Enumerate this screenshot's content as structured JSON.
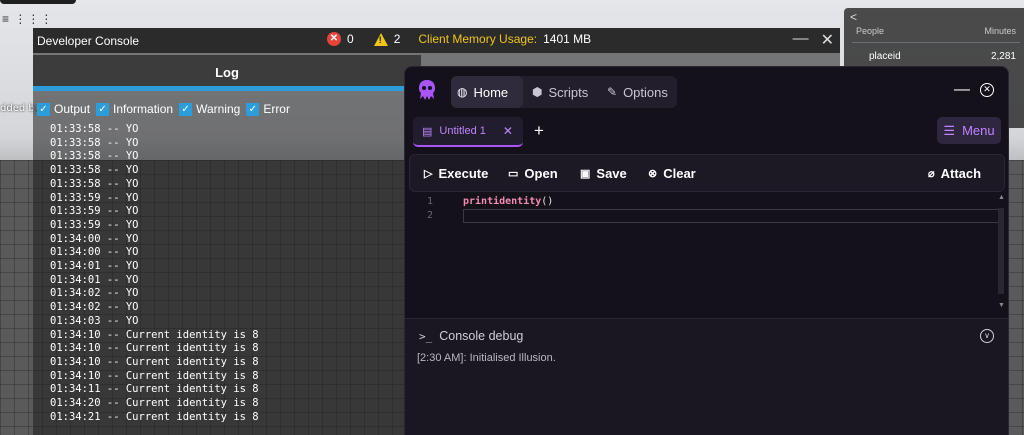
{
  "roblox": {
    "top_menu": "≡ ⋮⋮⋮",
    "added_text": "dded by"
  },
  "people_panel": {
    "collapse_glyph": "<",
    "header_left": "People",
    "header_right": "Minutes",
    "row_name": "placeid",
    "row_value": "2,281"
  },
  "dev_console": {
    "title": "Developer Console",
    "error_count": "0",
    "warning_count": "2",
    "memory_label": "Client Memory Usage:",
    "memory_value": "1401 MB",
    "tab_log": "Log",
    "filters": [
      "Output",
      "Information",
      "Warning",
      "Error"
    ],
    "log_lines": [
      "01:33:58 -- YO",
      "01:33:58 -- YO",
      "01:33:58 -- YO",
      "01:33:58 -- YO",
      "01:33:58 -- YO",
      "01:33:59 -- YO",
      "01:33:59 -- YO",
      "01:33:59 -- YO",
      "01:34:00 -- YO",
      "01:34:00 -- YO",
      "01:34:01 -- YO",
      "01:34:01 -- YO",
      "01:34:02 -- YO",
      "01:34:02 -- YO",
      "01:34:03 -- YO",
      "01:34:10 -- Current identity is 8",
      "01:34:10 -- Current identity is 8",
      "01:34:10 -- Current identity is 8",
      "01:34:10 -- Current identity is 8",
      "01:34:11 -- Current identity is 8",
      "01:34:20 -- Current identity is 8",
      "01:34:21 -- Current identity is 8"
    ]
  },
  "executor": {
    "nav": {
      "home": "Home",
      "scripts": "Scripts",
      "options": "Options"
    },
    "tab_name": "Untitled 1",
    "menu_label": "Menu",
    "toolbar": {
      "execute": "Execute",
      "open": "Open",
      "save": "Save",
      "clear": "Clear",
      "attach": "Attach"
    },
    "editor": {
      "line_numbers": [
        "1",
        "2"
      ],
      "code_fn": "printidentity",
      "code_parens": "()"
    },
    "console": {
      "title": "Console debug",
      "prompt": ">_",
      "message": "[2:30 AM]: Initialised Illusion."
    },
    "accent_color": "#a855f7"
  }
}
